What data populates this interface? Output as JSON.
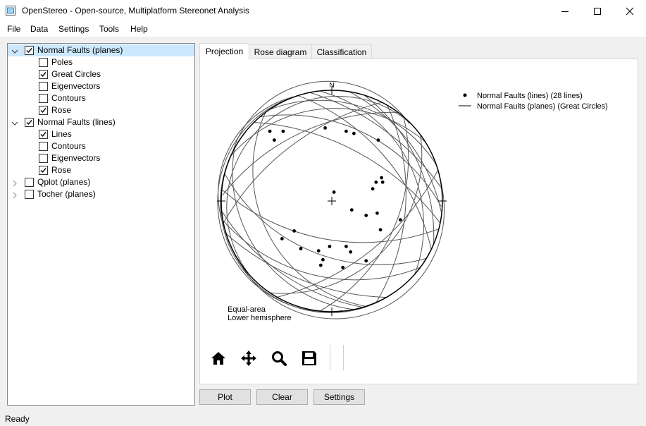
{
  "window": {
    "title": "OpenStereo - Open-source, Multiplatform Stereonet Analysis"
  },
  "menu": [
    "File",
    "Data",
    "Settings",
    "Tools",
    "Help"
  ],
  "tree": [
    {
      "label": "Normal Faults (planes)",
      "checked": true,
      "expanded": true,
      "selected": true,
      "children": [
        {
          "label": "Poles",
          "checked": false
        },
        {
          "label": "Great Circles",
          "checked": true
        },
        {
          "label": "Eigenvectors",
          "checked": false
        },
        {
          "label": "Contours",
          "checked": false
        },
        {
          "label": "Rose",
          "checked": true
        }
      ]
    },
    {
      "label": "Normal Faults (lines)",
      "checked": true,
      "expanded": true,
      "selected": false,
      "children": [
        {
          "label": "Lines",
          "checked": true
        },
        {
          "label": "Contours",
          "checked": false
        },
        {
          "label": "Eigenvectors",
          "checked": false
        },
        {
          "label": "Rose",
          "checked": true
        }
      ]
    },
    {
      "label": "Qplot (planes)",
      "checked": false,
      "expanded": false,
      "selected": false,
      "children": []
    },
    {
      "label": "Tocher (planes)",
      "checked": false,
      "expanded": false,
      "selected": false,
      "children": []
    }
  ],
  "tabs": [
    "Projection",
    "Rose diagram",
    "Classification"
  ],
  "active_tab": "Projection",
  "plot": {
    "north_label": "N",
    "legend": [
      {
        "marker": "dot",
        "label": "Normal Faults (lines) (28 lines)"
      },
      {
        "marker": "line",
        "label": "Normal Faults (planes) (Great Circles)"
      }
    ],
    "projection_label": "Equal-area",
    "hemisphere_label": "Lower hemisphere",
    "line_color": "#555555",
    "points": [
      [
        -0.56,
        0.63
      ],
      [
        -0.44,
        0.63
      ],
      [
        -0.52,
        0.55
      ],
      [
        -0.06,
        0.66
      ],
      [
        0.13,
        0.63
      ],
      [
        0.2,
        0.61
      ],
      [
        0.42,
        0.55
      ],
      [
        0.45,
        0.21
      ],
      [
        0.46,
        0.17
      ],
      [
        0.37,
        0.11
      ],
      [
        0.4,
        0.17
      ],
      [
        0.02,
        0.08
      ],
      [
        0.18,
        -0.08
      ],
      [
        0.31,
        -0.13
      ],
      [
        0.41,
        -0.11
      ],
      [
        0.62,
        -0.17
      ],
      [
        0.44,
        -0.26
      ],
      [
        -0.34,
        -0.27
      ],
      [
        -0.45,
        -0.34
      ],
      [
        -0.28,
        -0.43
      ],
      [
        -0.12,
        -0.45
      ],
      [
        -0.02,
        -0.41
      ],
      [
        0.17,
        -0.46
      ],
      [
        0.13,
        -0.41
      ],
      [
        -0.08,
        -0.53
      ],
      [
        -0.1,
        -0.58
      ],
      [
        0.1,
        -0.6
      ],
      [
        0.31,
        -0.54
      ]
    ],
    "great_circles": [
      [
        -0.9,
        0.43,
        0.7,
        0.7
      ],
      [
        -0.55,
        0.83,
        0.95,
        0.32
      ],
      [
        -0.97,
        0.25,
        0.85,
        -0.52
      ],
      [
        -0.3,
        0.95,
        0.9,
        -0.44
      ],
      [
        -0.98,
        -0.2,
        0.45,
        0.89
      ],
      [
        -0.78,
        0.62,
        0.6,
        -0.8
      ],
      [
        -0.1,
        0.99,
        0.75,
        -0.66
      ],
      [
        0.3,
        0.95,
        0.92,
        -0.4
      ],
      [
        -0.99,
        -0.1,
        0.28,
        -0.96
      ],
      [
        -0.95,
        -0.3,
        0.5,
        -0.87
      ],
      [
        -0.85,
        -0.52,
        0.99,
        0.15
      ],
      [
        -0.6,
        0.8,
        0.3,
        -0.95
      ],
      [
        0.15,
        0.99,
        0.99,
        -0.1
      ],
      [
        -0.99,
        0.1,
        0.97,
        -0.25
      ],
      [
        -0.7,
        0.71,
        0.98,
        -0.2
      ],
      [
        -0.4,
        0.92,
        0.1,
        -0.99
      ],
      [
        -0.92,
        0.4,
        0.85,
        0.53
      ],
      [
        -0.98,
        -0.18,
        0.8,
        -0.6
      ],
      [
        0.5,
        0.87,
        0.4,
        -0.92
      ],
      [
        -0.2,
        0.98,
        0.99,
        0.12
      ],
      [
        -0.75,
        -0.66,
        0.7,
        0.71
      ],
      [
        -0.88,
        0.47,
        0.2,
        -0.98
      ],
      [
        0.65,
        0.76,
        -0.1,
        -0.99
      ],
      [
        -0.99,
        0.05,
        0.6,
        0.8
      ],
      [
        -0.5,
        -0.87,
        0.96,
        0.28
      ],
      [
        -0.3,
        0.95,
        -0.95,
        -0.3
      ],
      [
        0.8,
        0.6,
        -0.55,
        -0.83
      ],
      [
        -0.65,
        0.76,
        0.99,
        -0.05
      ]
    ]
  },
  "toolbar": [
    "home-icon",
    "pan-icon",
    "zoom-icon",
    "save-icon"
  ],
  "buttons": {
    "plot": "Plot",
    "clear": "Clear",
    "settings": "Settings"
  },
  "status": "Ready"
}
